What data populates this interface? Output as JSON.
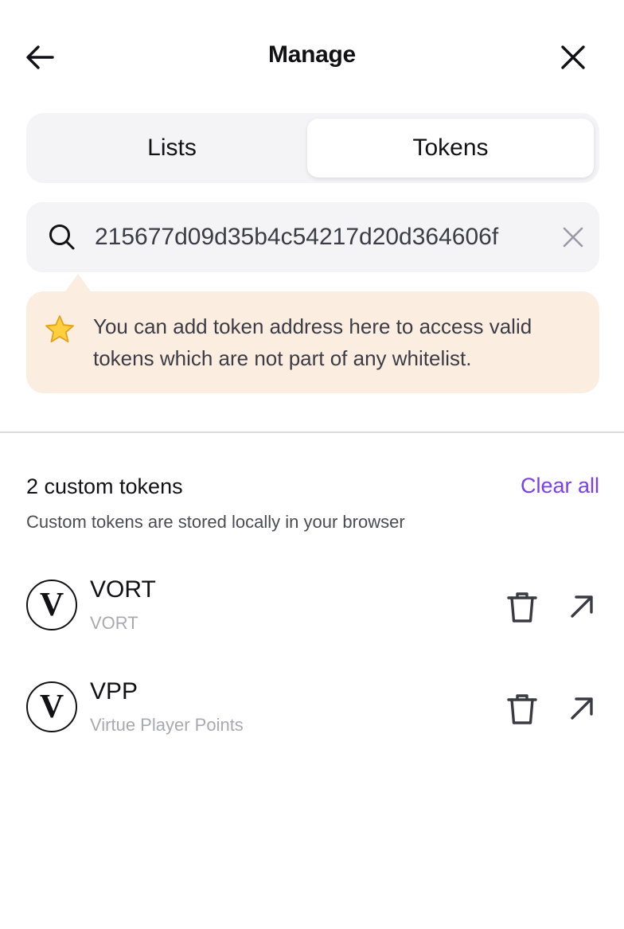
{
  "header": {
    "title": "Manage",
    "back_icon": "arrow-left-icon",
    "close_icon": "close-icon"
  },
  "tabs": [
    {
      "label": "Lists",
      "active": false
    },
    {
      "label": "Tokens",
      "active": true
    }
  ],
  "search": {
    "value": "215677d09d35b4c54217d20d364606f",
    "search_icon": "search-icon",
    "clear_icon": "clear-icon"
  },
  "tip": {
    "icon": "star-icon",
    "text": "You can add token address here to access valid tokens which are not part of any whitelist."
  },
  "custom_tokens": {
    "count_label": "2 custom tokens",
    "clear_all_label": "Clear all",
    "description": "Custom tokens are stored locally in your browser",
    "items": [
      {
        "logo_letter": "V",
        "symbol": "VORT",
        "name": "VORT"
      },
      {
        "logo_letter": "V",
        "symbol": "VPP",
        "name": "Virtue Player Points"
      }
    ]
  },
  "colors": {
    "accent": "#7a3ff2",
    "tip_background": "#fcede1",
    "panel_background": "#f4f4f6",
    "text_primary": "#111116",
    "text_muted": "#a9a9b2"
  }
}
